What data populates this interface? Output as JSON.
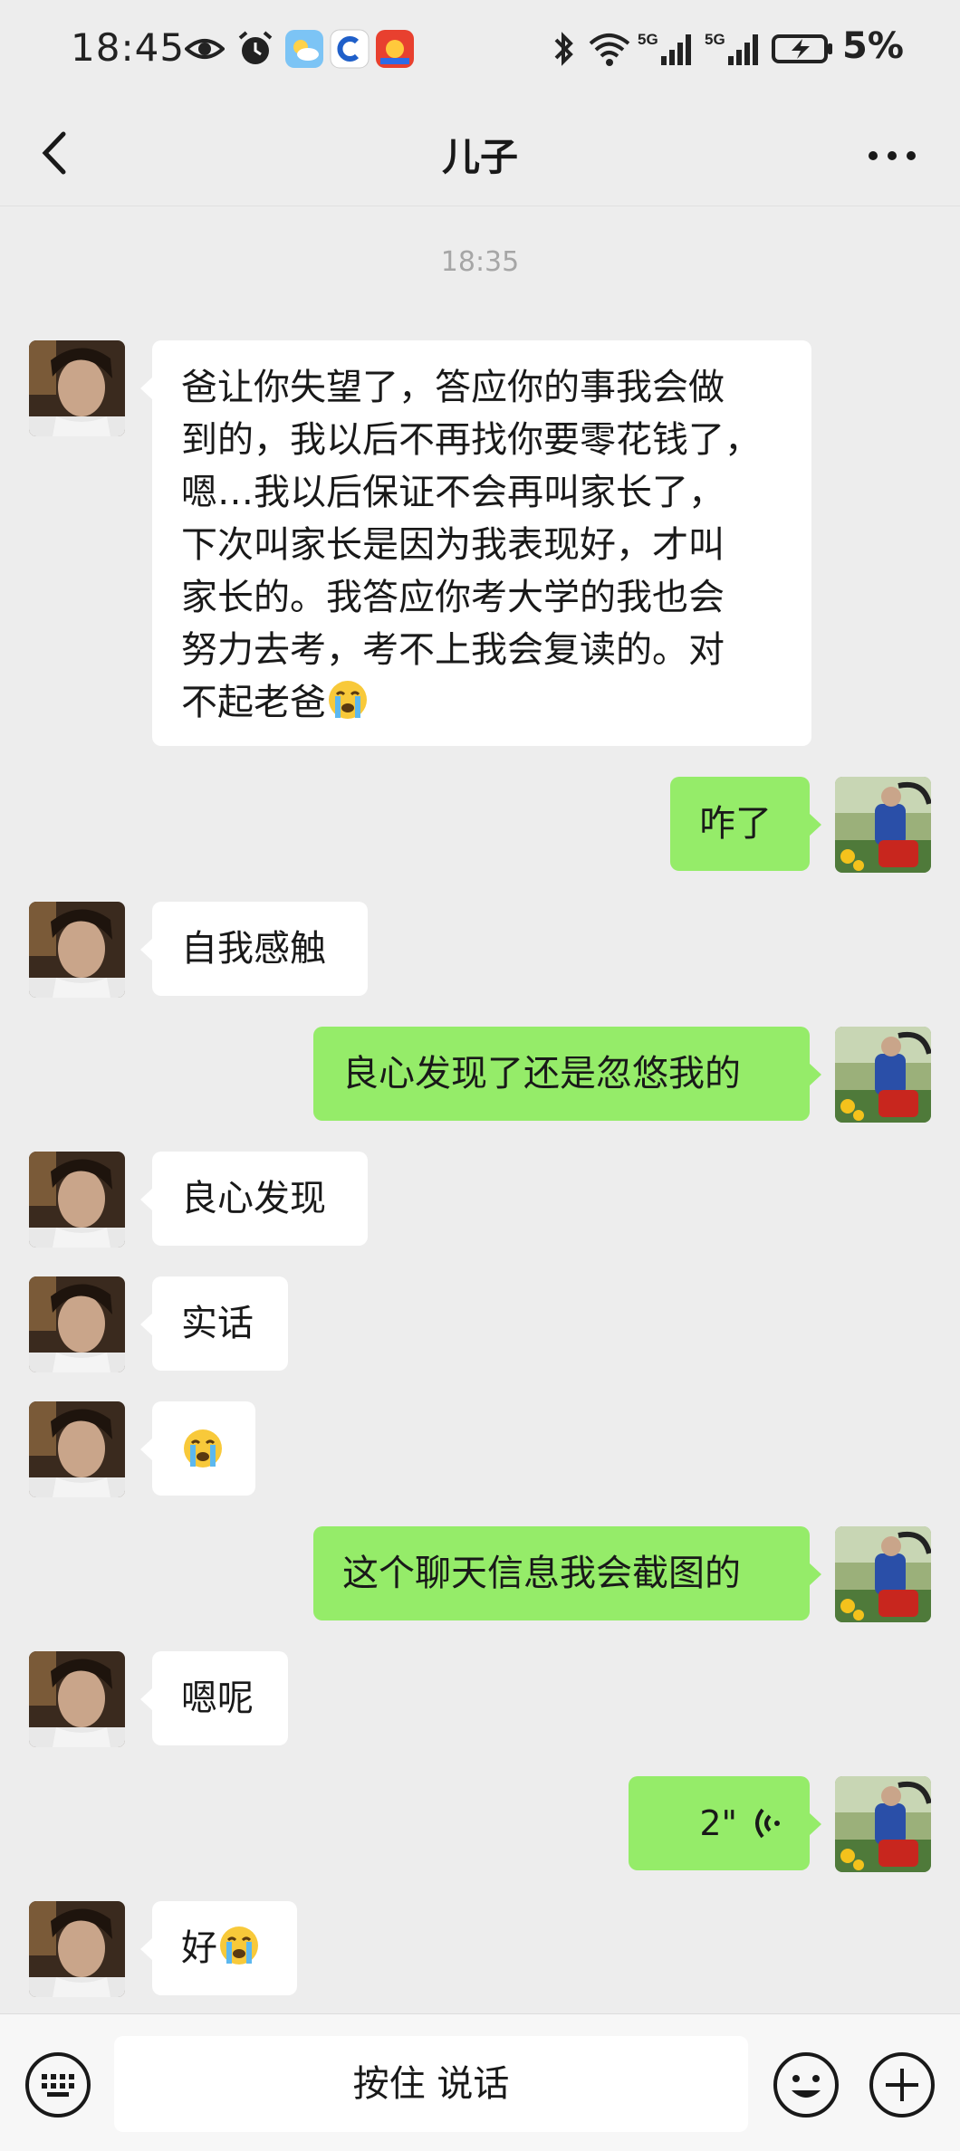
{
  "status_bar": {
    "time": "18:45",
    "battery_percent": "5%",
    "network_1": "5G",
    "network_2": "5G",
    "icons": [
      "eye-icon",
      "alarm-icon",
      "weather-app-icon",
      "app-c-icon",
      "app-shop-icon",
      "bluetooth-icon",
      "wifi-icon",
      "signal-icon",
      "battery-charging-icon"
    ]
  },
  "header": {
    "title": "儿子"
  },
  "chat": {
    "timestamp": "18:35",
    "messages": [
      {
        "side": "in",
        "text": "爸让你失望了，答应你的事我会做\n到的，我以后不再找你要零花钱了，\n嗯…我以后保证不会再叫家长了，\n下次叫家长是因为我表现好，才叫\n家长的。我答应你考大学的我也会\n努力去考，考不上我会复读的。对\n不起老爸",
        "emoji": "crying-face"
      },
      {
        "side": "out",
        "text": "咋了"
      },
      {
        "side": "in",
        "text": "自我感触"
      },
      {
        "side": "out",
        "text": "良心发现了还是忽悠我的"
      },
      {
        "side": "in",
        "text": "良心发现"
      },
      {
        "side": "in",
        "text": "实话"
      },
      {
        "side": "in",
        "text": "",
        "emoji": "crying-face"
      },
      {
        "side": "out",
        "text": "这个聊天信息我会截图的"
      },
      {
        "side": "in",
        "text": "嗯呢"
      },
      {
        "side": "out",
        "type": "voice",
        "duration": "2\""
      },
      {
        "side": "in",
        "text": "好",
        "emoji": "crying-face"
      }
    ]
  },
  "bottom_bar": {
    "hold_to_talk": "按住 说话"
  },
  "colors": {
    "background": "#ededed",
    "outgoing_bubble": "#95ec69",
    "incoming_bubble": "#ffffff"
  }
}
